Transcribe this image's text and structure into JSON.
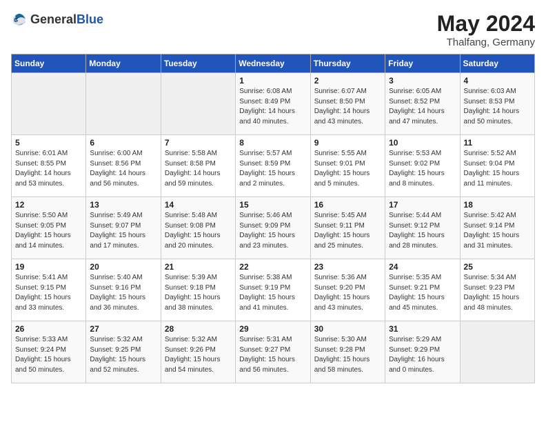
{
  "header": {
    "logo_general": "General",
    "logo_blue": "Blue",
    "title": "May 2024",
    "location": "Thalfang, Germany"
  },
  "weekdays": [
    "Sunday",
    "Monday",
    "Tuesday",
    "Wednesday",
    "Thursday",
    "Friday",
    "Saturday"
  ],
  "weeks": [
    [
      {
        "day": "",
        "info": ""
      },
      {
        "day": "",
        "info": ""
      },
      {
        "day": "",
        "info": ""
      },
      {
        "day": "1",
        "info": "Sunrise: 6:08 AM\nSunset: 8:49 PM\nDaylight: 14 hours\nand 40 minutes."
      },
      {
        "day": "2",
        "info": "Sunrise: 6:07 AM\nSunset: 8:50 PM\nDaylight: 14 hours\nand 43 minutes."
      },
      {
        "day": "3",
        "info": "Sunrise: 6:05 AM\nSunset: 8:52 PM\nDaylight: 14 hours\nand 47 minutes."
      },
      {
        "day": "4",
        "info": "Sunrise: 6:03 AM\nSunset: 8:53 PM\nDaylight: 14 hours\nand 50 minutes."
      }
    ],
    [
      {
        "day": "5",
        "info": "Sunrise: 6:01 AM\nSunset: 8:55 PM\nDaylight: 14 hours\nand 53 minutes."
      },
      {
        "day": "6",
        "info": "Sunrise: 6:00 AM\nSunset: 8:56 PM\nDaylight: 14 hours\nand 56 minutes."
      },
      {
        "day": "7",
        "info": "Sunrise: 5:58 AM\nSunset: 8:58 PM\nDaylight: 14 hours\nand 59 minutes."
      },
      {
        "day": "8",
        "info": "Sunrise: 5:57 AM\nSunset: 8:59 PM\nDaylight: 15 hours\nand 2 minutes."
      },
      {
        "day": "9",
        "info": "Sunrise: 5:55 AM\nSunset: 9:01 PM\nDaylight: 15 hours\nand 5 minutes."
      },
      {
        "day": "10",
        "info": "Sunrise: 5:53 AM\nSunset: 9:02 PM\nDaylight: 15 hours\nand 8 minutes."
      },
      {
        "day": "11",
        "info": "Sunrise: 5:52 AM\nSunset: 9:04 PM\nDaylight: 15 hours\nand 11 minutes."
      }
    ],
    [
      {
        "day": "12",
        "info": "Sunrise: 5:50 AM\nSunset: 9:05 PM\nDaylight: 15 hours\nand 14 minutes."
      },
      {
        "day": "13",
        "info": "Sunrise: 5:49 AM\nSunset: 9:07 PM\nDaylight: 15 hours\nand 17 minutes."
      },
      {
        "day": "14",
        "info": "Sunrise: 5:48 AM\nSunset: 9:08 PM\nDaylight: 15 hours\nand 20 minutes."
      },
      {
        "day": "15",
        "info": "Sunrise: 5:46 AM\nSunset: 9:09 PM\nDaylight: 15 hours\nand 23 minutes."
      },
      {
        "day": "16",
        "info": "Sunrise: 5:45 AM\nSunset: 9:11 PM\nDaylight: 15 hours\nand 25 minutes."
      },
      {
        "day": "17",
        "info": "Sunrise: 5:44 AM\nSunset: 9:12 PM\nDaylight: 15 hours\nand 28 minutes."
      },
      {
        "day": "18",
        "info": "Sunrise: 5:42 AM\nSunset: 9:14 PM\nDaylight: 15 hours\nand 31 minutes."
      }
    ],
    [
      {
        "day": "19",
        "info": "Sunrise: 5:41 AM\nSunset: 9:15 PM\nDaylight: 15 hours\nand 33 minutes."
      },
      {
        "day": "20",
        "info": "Sunrise: 5:40 AM\nSunset: 9:16 PM\nDaylight: 15 hours\nand 36 minutes."
      },
      {
        "day": "21",
        "info": "Sunrise: 5:39 AM\nSunset: 9:18 PM\nDaylight: 15 hours\nand 38 minutes."
      },
      {
        "day": "22",
        "info": "Sunrise: 5:38 AM\nSunset: 9:19 PM\nDaylight: 15 hours\nand 41 minutes."
      },
      {
        "day": "23",
        "info": "Sunrise: 5:36 AM\nSunset: 9:20 PM\nDaylight: 15 hours\nand 43 minutes."
      },
      {
        "day": "24",
        "info": "Sunrise: 5:35 AM\nSunset: 9:21 PM\nDaylight: 15 hours\nand 45 minutes."
      },
      {
        "day": "25",
        "info": "Sunrise: 5:34 AM\nSunset: 9:23 PM\nDaylight: 15 hours\nand 48 minutes."
      }
    ],
    [
      {
        "day": "26",
        "info": "Sunrise: 5:33 AM\nSunset: 9:24 PM\nDaylight: 15 hours\nand 50 minutes."
      },
      {
        "day": "27",
        "info": "Sunrise: 5:32 AM\nSunset: 9:25 PM\nDaylight: 15 hours\nand 52 minutes."
      },
      {
        "day": "28",
        "info": "Sunrise: 5:32 AM\nSunset: 9:26 PM\nDaylight: 15 hours\nand 54 minutes."
      },
      {
        "day": "29",
        "info": "Sunrise: 5:31 AM\nSunset: 9:27 PM\nDaylight: 15 hours\nand 56 minutes."
      },
      {
        "day": "30",
        "info": "Sunrise: 5:30 AM\nSunset: 9:28 PM\nDaylight: 15 hours\nand 58 minutes."
      },
      {
        "day": "31",
        "info": "Sunrise: 5:29 AM\nSunset: 9:29 PM\nDaylight: 16 hours\nand 0 minutes."
      },
      {
        "day": "",
        "info": ""
      }
    ]
  ]
}
